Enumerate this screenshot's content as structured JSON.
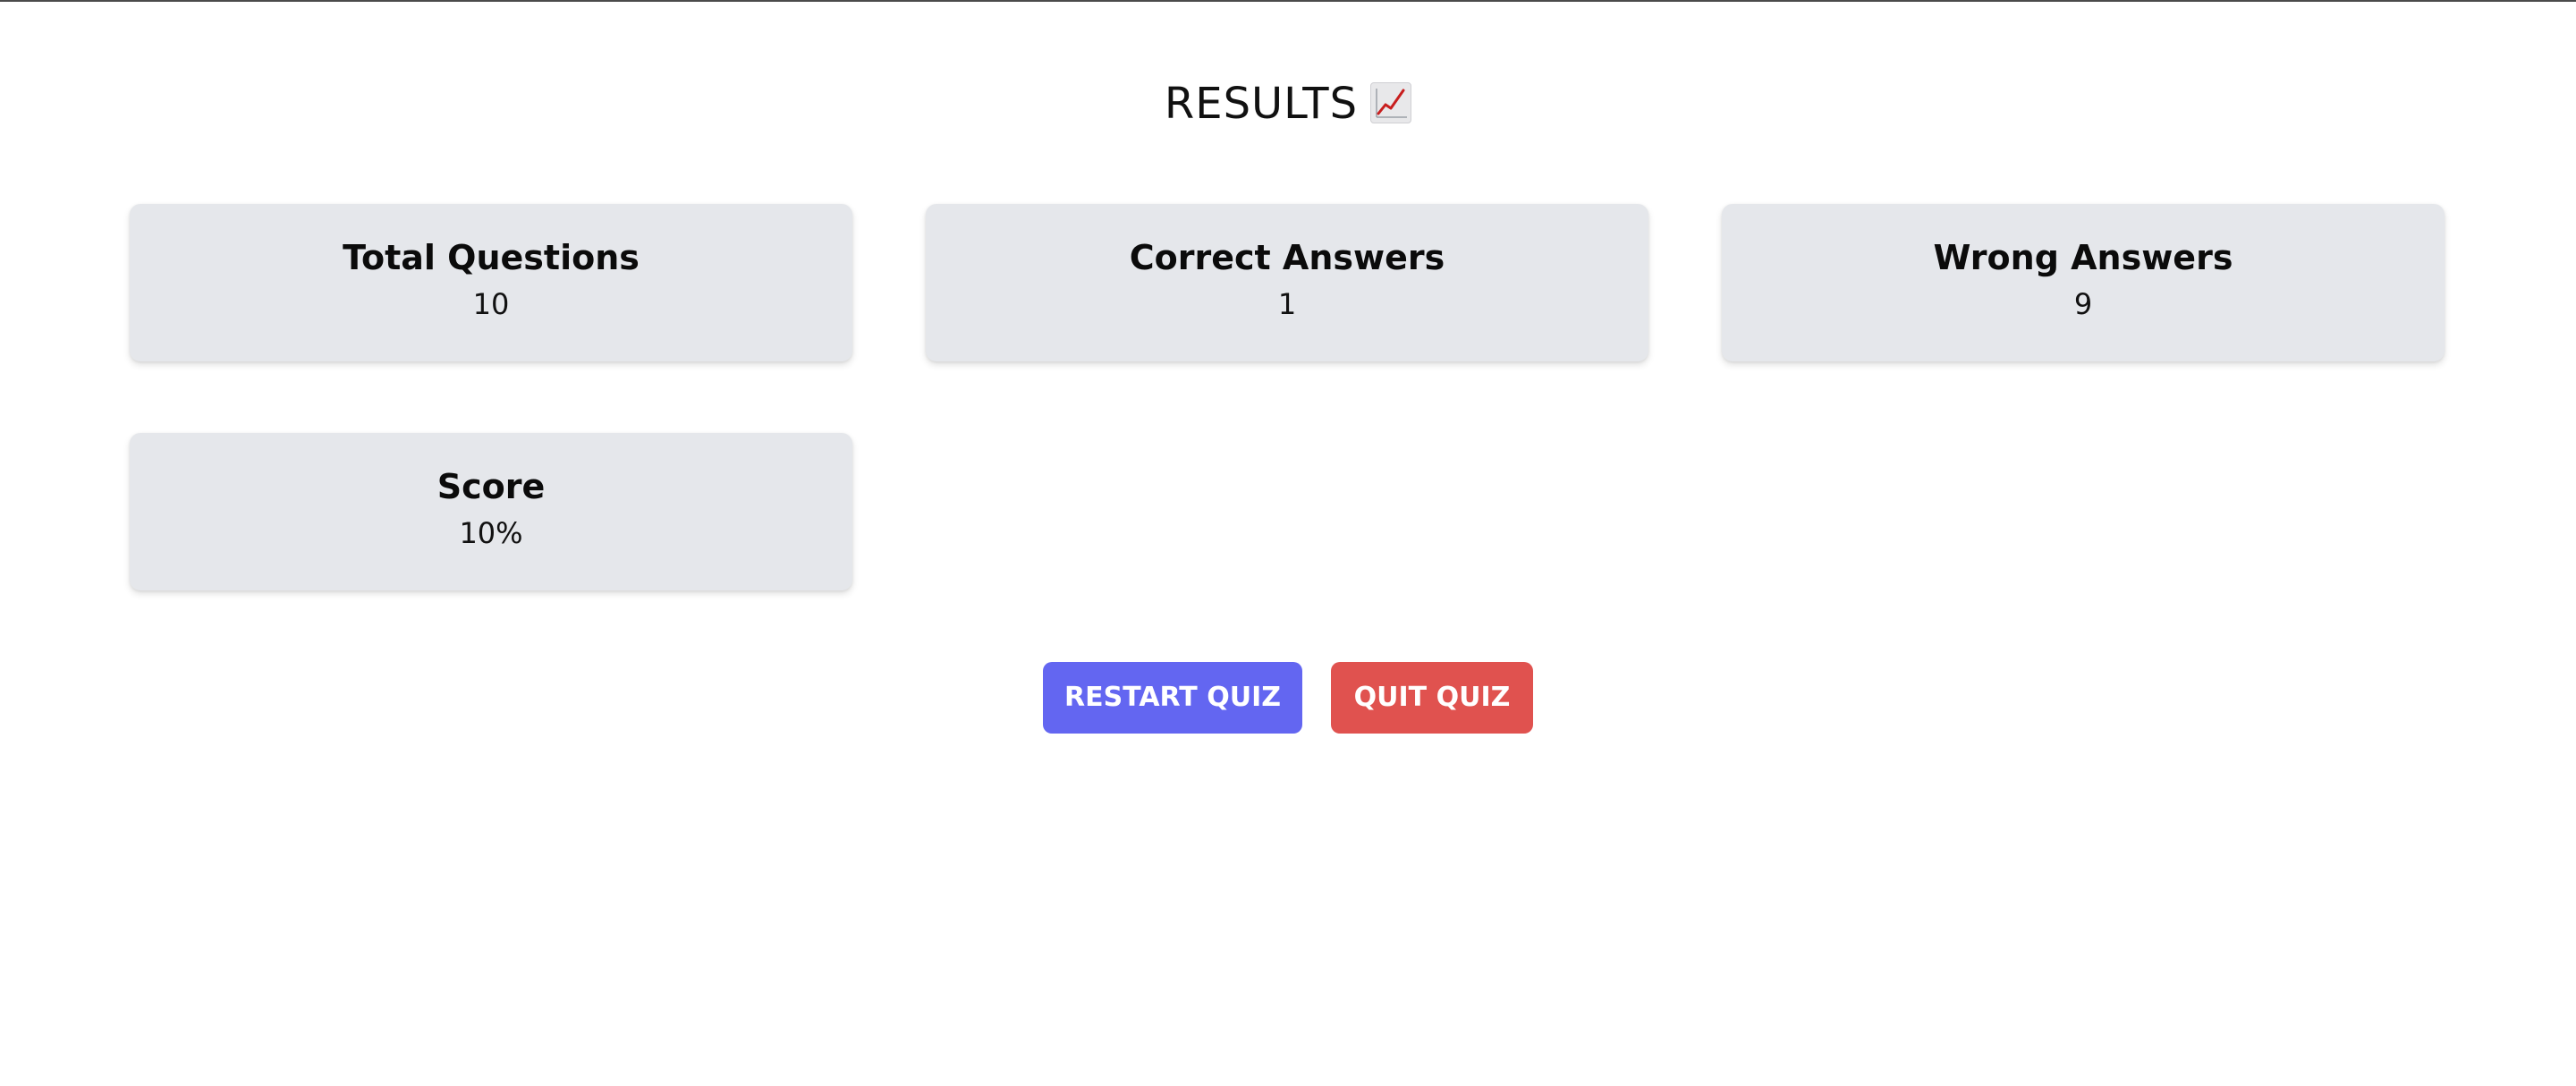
{
  "header": {
    "title": "RESULTS",
    "title_icon": "chart-increasing-icon"
  },
  "stats": [
    {
      "label": "Total Questions",
      "value": "10"
    },
    {
      "label": "Correct Answers",
      "value": "1"
    },
    {
      "label": "Wrong Answers",
      "value": "9"
    },
    {
      "label": "Score",
      "value": "10%"
    }
  ],
  "actions": {
    "restart_label": "RESTART QUIZ",
    "quit_label": "QUIT QUIZ"
  },
  "colors": {
    "card_background": "#e5e7eb",
    "restart_button": "#6366f1",
    "quit_button": "#e0524f"
  }
}
